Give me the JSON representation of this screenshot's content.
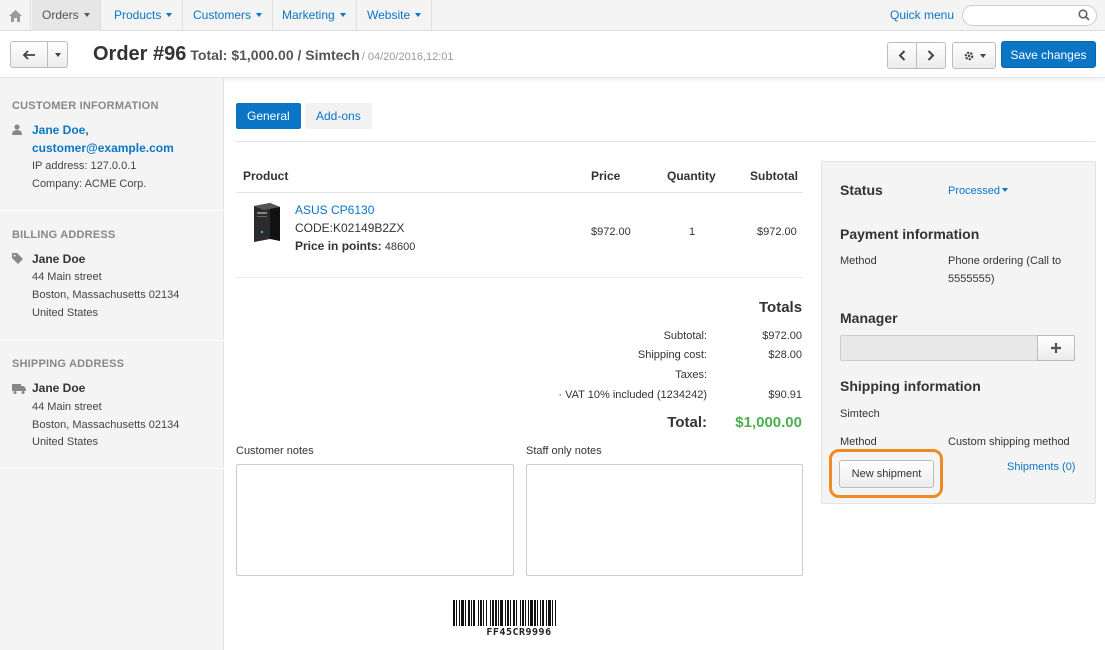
{
  "nav": {
    "items": [
      {
        "label": "Orders"
      },
      {
        "label": "Products"
      },
      {
        "label": "Customers"
      },
      {
        "label": "Marketing"
      },
      {
        "label": "Website"
      }
    ],
    "quick_menu": "Quick menu",
    "search_placeholder": ""
  },
  "header": {
    "order_title": "Order #96",
    "total_text": "Total: $1,000.00 / Simtech",
    "date_text": "/ 04/20/2016,12:01",
    "save_label": "Save changes"
  },
  "sidebar": {
    "customer": {
      "title": "Customer information",
      "name": "Jane Doe,",
      "email": "customer@example.com",
      "ip": "IP address: 127.0.0.1",
      "company": "Company: ACME Corp."
    },
    "billing": {
      "title": "Billing address",
      "name": "Jane Doe",
      "line1": "44 Main street",
      "line2": "Boston, Massachusetts 02134",
      "line3": "United States"
    },
    "shipping": {
      "title": "Shipping address",
      "name": "Jane Doe",
      "line1": "44 Main street",
      "line2": "Boston, Massachusetts 02134",
      "line3": "United States"
    }
  },
  "tabs": [
    {
      "label": "General"
    },
    {
      "label": "Add-ons"
    }
  ],
  "products_table": {
    "headers": [
      "Product",
      "Price",
      "Quantity",
      "Subtotal"
    ],
    "rows": [
      {
        "name": "ASUS CP6130",
        "code": "CODE:K02149B2ZX",
        "points_label": "Price in points:",
        "points_value": "48600",
        "price": "$972.00",
        "quantity": "1",
        "subtotal": "$972.00"
      }
    ]
  },
  "totals": {
    "title": "Totals",
    "subtotal_label": "Subtotal:",
    "subtotal_value": "$972.00",
    "shipping_label": "Shipping cost:",
    "shipping_value": "$28.00",
    "taxes_label": "Taxes:",
    "vat_label": "· VAT 10% included (1234242)",
    "vat_value": "$90.91",
    "total_label": "Total:",
    "total_value": "$1,000.00"
  },
  "notes": {
    "customer_label": "Customer notes",
    "staff_label": "Staff only notes"
  },
  "barcode_text": "FF45CR9996",
  "panel": {
    "status_label": "Status",
    "status_value": "Processed",
    "payment_title": "Payment information",
    "method_label": "Method",
    "payment_method": "Phone ordering (Call to 5555555)",
    "manager_title": "Manager",
    "shipping_title": "Shipping information",
    "shipping_company": "Simtech",
    "shipping_method_label": "Method",
    "shipping_method": "Custom shipping method",
    "new_shipment": "New shipment",
    "shipments_link": "Shipments (0)"
  },
  "colors": {
    "accent": "#0b75c5",
    "total_green": "#4caf50",
    "highlight": "#f08a24"
  }
}
